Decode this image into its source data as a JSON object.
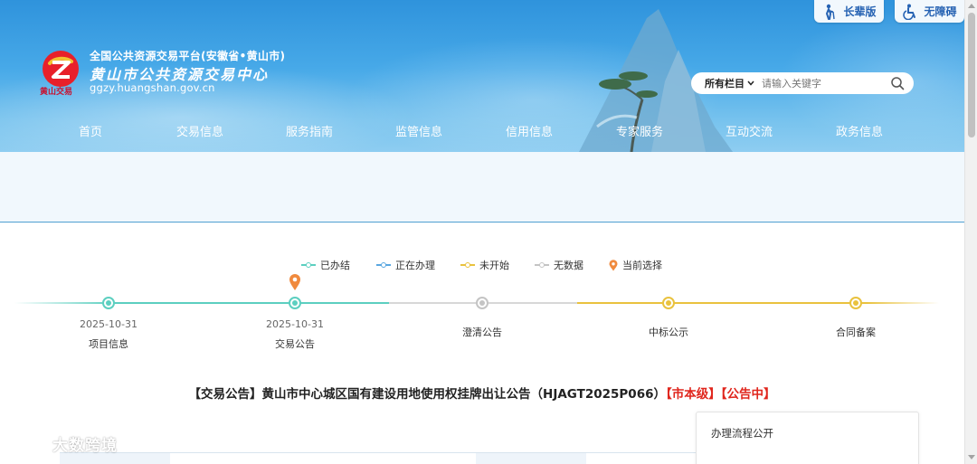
{
  "header": {
    "site_line1": "全国公共资源交易平台(安徽省•黄山市)",
    "site_line2": "黄山市公共资源交易中心",
    "site_url": "ggzy.huangshan.gov.cn",
    "logo_caption": "黄山交易",
    "elder_mode_label": "长辈版",
    "accessibility_label": "无障碍",
    "search": {
      "scope_label": "所有栏目",
      "placeholder": "请输入关键字"
    },
    "nav": [
      {
        "label": "首页"
      },
      {
        "label": "交易信息"
      },
      {
        "label": "服务指南"
      },
      {
        "label": "监管信息"
      },
      {
        "label": "信用信息"
      },
      {
        "label": "专家服务"
      },
      {
        "label": "互动交流"
      },
      {
        "label": "政务信息"
      }
    ]
  },
  "legend": [
    {
      "label": "已办结",
      "color": "#5ccfc0"
    },
    {
      "label": "正在办理",
      "color": "#5aa7e0"
    },
    {
      "label": "未开始",
      "color": "#e9c23e"
    },
    {
      "label": "无数据",
      "color": "#c4c4c4"
    },
    {
      "label": "当前选择",
      "color": "#f08a3e"
    }
  ],
  "timeline": {
    "steps": [
      {
        "label": "项目信息",
        "date": "2025-10-31",
        "status": "done"
      },
      {
        "label": "交易公告",
        "date": "2025-10-31",
        "status": "done",
        "current": true
      },
      {
        "label": "澄清公告",
        "date": "",
        "status": "nodata"
      },
      {
        "label": "中标公示",
        "date": "",
        "status": "pending"
      },
      {
        "label": "合同备案",
        "date": "",
        "status": "pending"
      }
    ]
  },
  "notice": {
    "prefix": "【交易公告】黄山市中心城区国有建设用地使用权挂牌出让公告（HJAGT2025P066）",
    "level_tag": "【市本级】",
    "status_tag": "【公告中】"
  },
  "side_panel": {
    "title": "办理流程公开"
  },
  "watermark": {
    "text": "大数跨境"
  },
  "colors": {
    "banner_blue": "#2f93dc",
    "accent_red": "#e0261d",
    "done": "#5ccfc0",
    "pending": "#e9c23e",
    "nodata": "#c4c4c4",
    "current_pin": "#f08a3e"
  }
}
